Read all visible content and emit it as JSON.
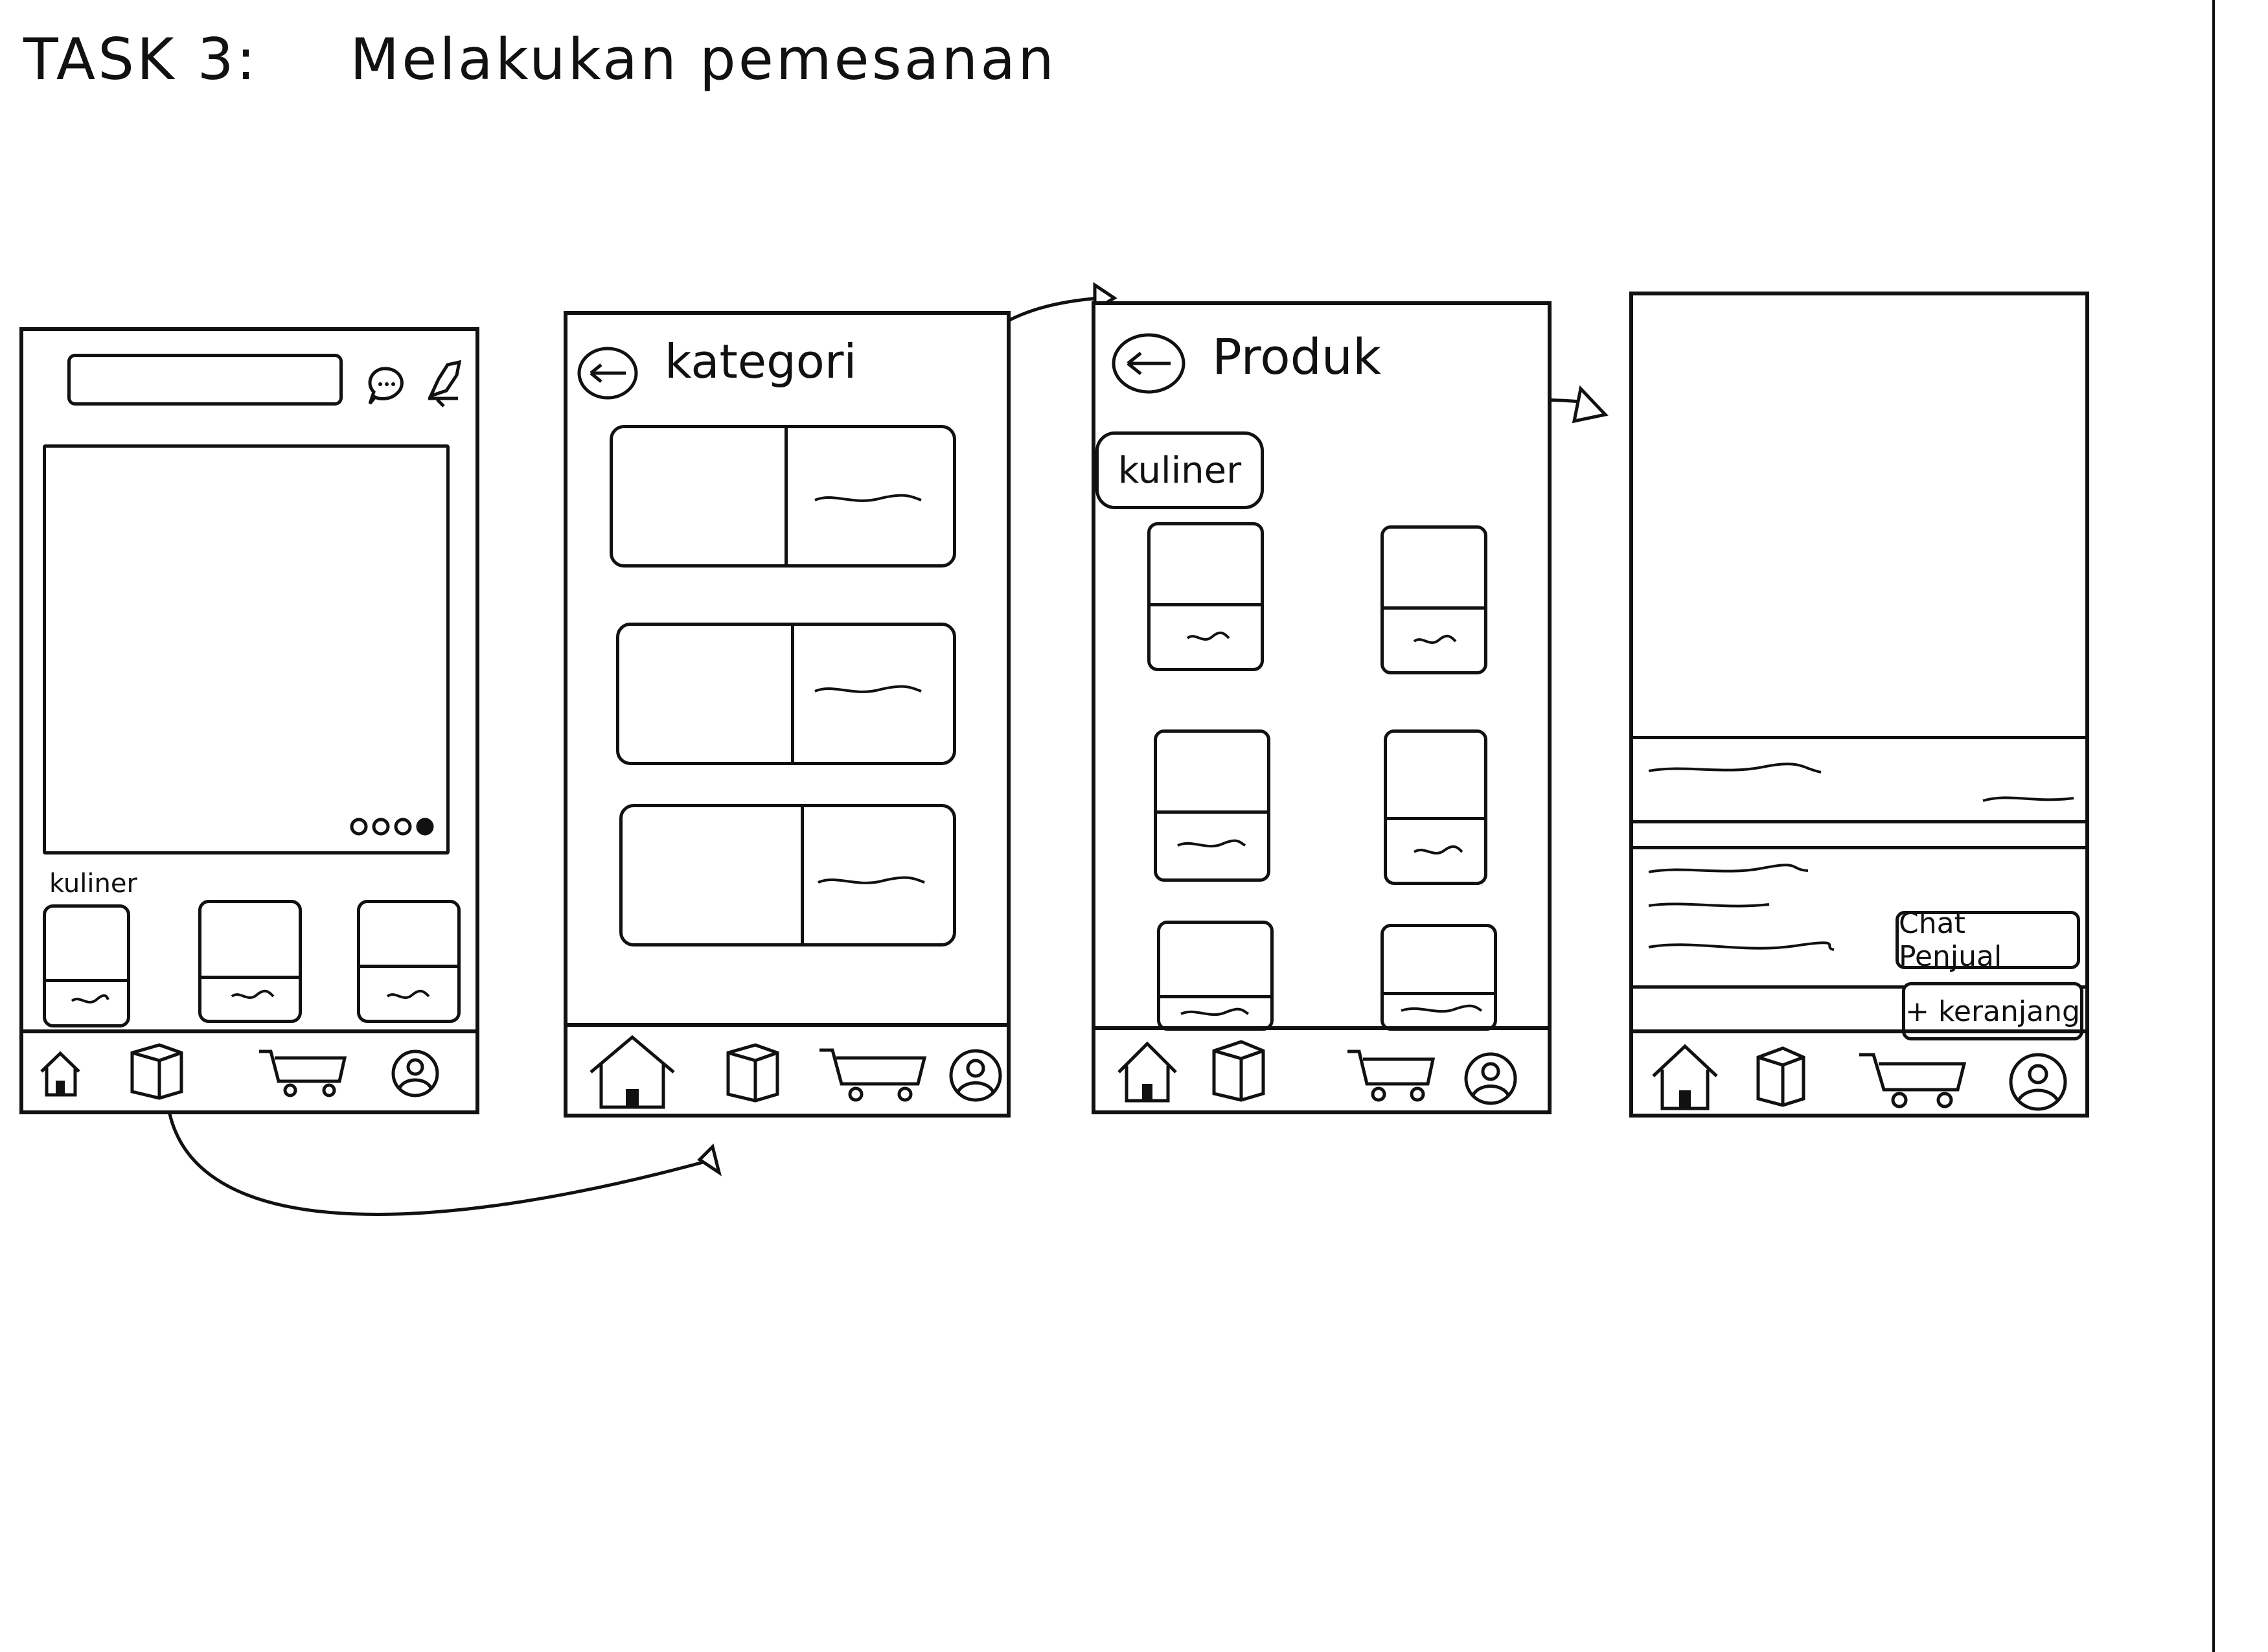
{
  "page": {
    "title_prefix": "TASK 3:",
    "title_text": "Melakukan pemesanan"
  },
  "screen1": {
    "section_label": "kuliner",
    "carousel_dots": 4,
    "icons": [
      "search-bar",
      "chat-icon",
      "bell-icon"
    ],
    "nav_icons": [
      "home-icon",
      "box-icon",
      "cart-icon",
      "profile-icon"
    ]
  },
  "screen2": {
    "header_title": "kategori",
    "category_count": 3
  },
  "screen3": {
    "header_title": "Produk",
    "filter_chip": "kuliner",
    "product_count": 6
  },
  "screen4": {
    "chat_button": "Chat Penjual",
    "cart_button": "+ keranjang"
  },
  "colors": {
    "ink": "#111111",
    "paper": "#ffffff"
  }
}
